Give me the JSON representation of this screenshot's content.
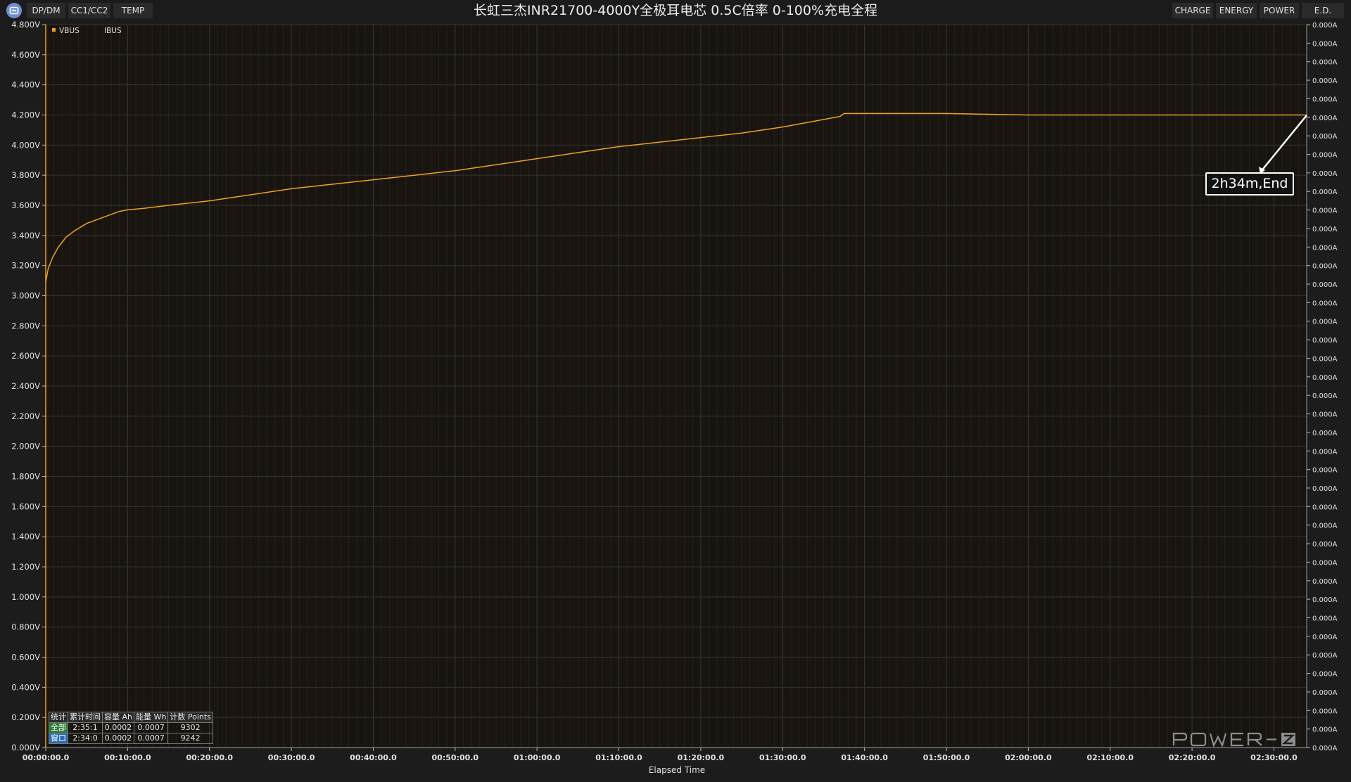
{
  "title": "长虹三杰INR21700-4000Y全极耳电芯 0.5C倍率 0-100%充电全程",
  "tabs_left": [
    "DP/DM",
    "CC1/CC2",
    "TEMP"
  ],
  "tabs_right": [
    "CHARGE",
    "ENERGY",
    "POWER",
    "E.D."
  ],
  "icons": {
    "app_logo": "app-logo-icon",
    "legend_marker": "square-legend-icon"
  },
  "colors": {
    "vbus": "#f0a020",
    "background": "#1c1c1c",
    "plot_background": "#181410",
    "annotation_border": "#ffffff",
    "stats_all": "#2f7d3a",
    "stats_window": "#2b6bb5"
  },
  "annotation": {
    "text": "2h34m,End"
  },
  "watermark": "POWER-Z",
  "stats": {
    "headers": [
      "统计",
      "累计时间",
      "容量 Ah",
      "能量 Wh",
      "计数 Points"
    ],
    "rows": [
      {
        "label": "全部",
        "time": "2:35:1",
        "capacity": "0.0002",
        "energy": "0.0007",
        "points": "9302"
      },
      {
        "label": "窗口",
        "time": "2:34:0",
        "capacity": "0.0002",
        "energy": "0.0007",
        "points": "9242"
      }
    ]
  },
  "chart_data": {
    "type": "line",
    "title": "长虹三杰INR21700-4000Y全极耳电芯 0.5C倍率 0-100%充电全程",
    "xlabel": "Elapsed Time",
    "ylabel": "",
    "y2label": "",
    "legend": [
      "VBUS",
      "IBUS"
    ],
    "legend_position": "top-left",
    "grid": true,
    "x_unit": "minutes",
    "xlim": [
      0,
      154
    ],
    "ylim": [
      0,
      4.8
    ],
    "y2lim": [
      0,
      0
    ],
    "x_ticks": [
      "00:00:00.0",
      "00:10:00.0",
      "00:20:00.0",
      "00:30:00.0",
      "00:40:00.0",
      "00:50:00.0",
      "01:00:00.0",
      "01:10:00.0",
      "01:20:00.0",
      "01:30:00.0",
      "01:40:00.0",
      "01:50:00.0",
      "02:00:00.0",
      "02:10:00.0",
      "02:20:00.0",
      "02:30:00.0"
    ],
    "y_ticks": [
      "4.800V",
      "4.600V",
      "4.400V",
      "4.200V",
      "4.000V",
      "3.800V",
      "3.600V",
      "3.400V",
      "3.200V",
      "3.000V",
      "2.800V",
      "2.600V",
      "2.400V",
      "2.200V",
      "2.000V",
      "1.800V",
      "1.600V",
      "1.400V",
      "1.200V",
      "1.000V",
      "0.800V",
      "0.600V",
      "0.400V",
      "0.200V",
      "0.000V"
    ],
    "y2_ticks": [
      "0.000A",
      "0.000A",
      "0.000A",
      "0.000A",
      "0.000A",
      "0.000A",
      "0.000A",
      "0.000A",
      "0.000A",
      "0.000A",
      "0.000A",
      "0.000A",
      "0.000A",
      "0.000A",
      "0.000A",
      "0.000A",
      "0.000A",
      "0.000A",
      "0.000A",
      "0.000A",
      "0.000A",
      "0.000A",
      "0.000A",
      "0.000A",
      "0.000A",
      "0.000A",
      "0.000A",
      "0.000A",
      "0.000A",
      "0.000A",
      "0.000A",
      "0.000A",
      "0.000A",
      "0.000A",
      "0.000A",
      "0.000A",
      "0.000A",
      "0.000A",
      "0.000A",
      "0.000A"
    ],
    "series": [
      {
        "name": "VBUS",
        "x": [
          0,
          0.3,
          0.8,
          1.5,
          2.5,
          3.5,
          5,
          6.5,
          8,
          9,
          10,
          12,
          15,
          20,
          25,
          30,
          35,
          40,
          45,
          50,
          55,
          60,
          65,
          70,
          75,
          80,
          85,
          90,
          93,
          95,
          97,
          97.5,
          100,
          110,
          120,
          130,
          140,
          150,
          154
        ],
        "y": [
          3.09,
          3.18,
          3.25,
          3.32,
          3.39,
          3.43,
          3.48,
          3.51,
          3.54,
          3.56,
          3.57,
          3.58,
          3.6,
          3.63,
          3.67,
          3.71,
          3.74,
          3.77,
          3.8,
          3.83,
          3.87,
          3.91,
          3.95,
          3.99,
          4.02,
          4.05,
          4.08,
          4.12,
          4.15,
          4.17,
          4.19,
          4.21,
          4.21,
          4.21,
          4.2,
          4.2,
          4.2,
          4.2,
          4.2
        ]
      },
      {
        "name": "IBUS",
        "x": [],
        "y": []
      }
    ]
  }
}
